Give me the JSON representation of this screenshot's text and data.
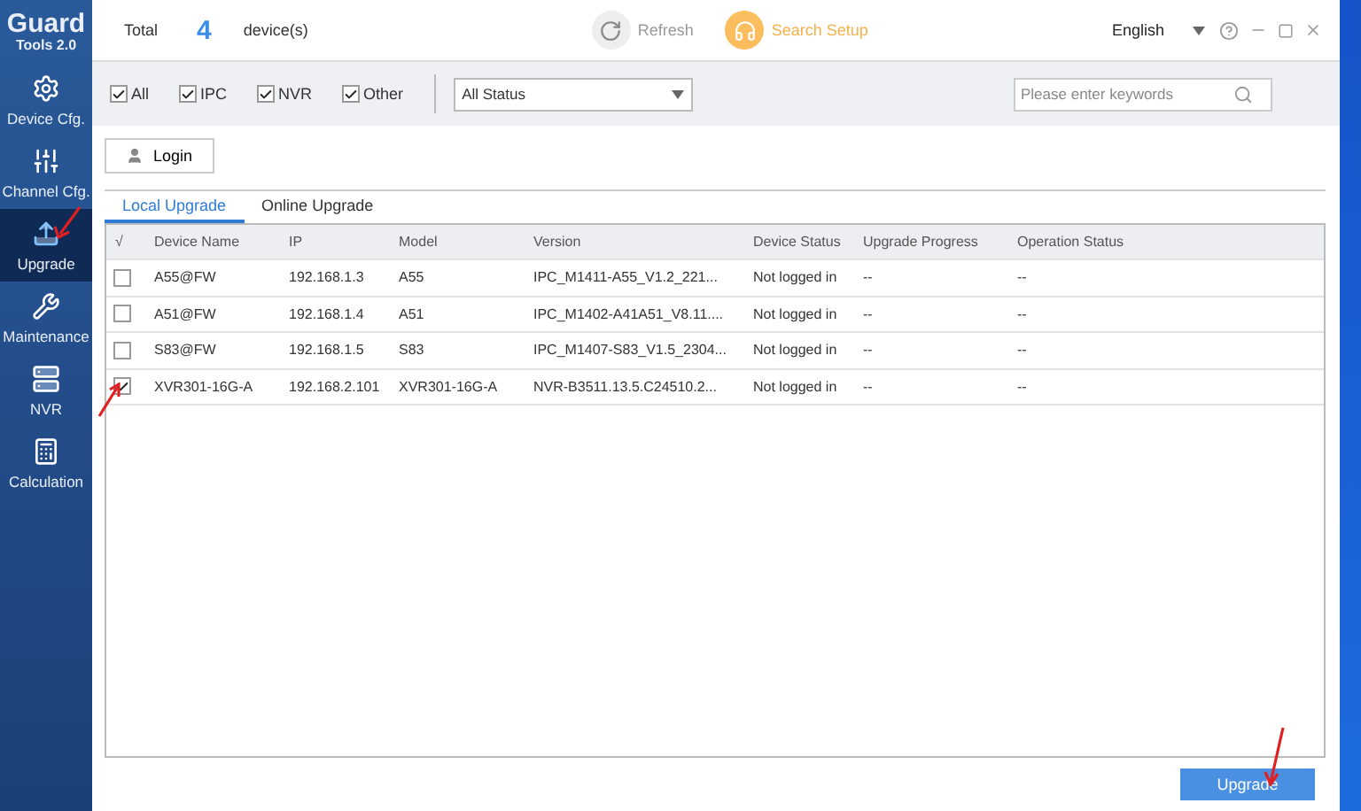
{
  "sidebar": {
    "logo": "Guard",
    "version": "Tools 2.0",
    "items": [
      {
        "label": "Device Cfg.",
        "kind": "gear",
        "selected": false
      },
      {
        "label": "Channel Cfg.",
        "kind": "sliders",
        "selected": false
      },
      {
        "label": "Upgrade",
        "kind": "upgrade",
        "selected": true
      },
      {
        "label": "Maintenance",
        "kind": "tools",
        "selected": false
      },
      {
        "label": "NVR",
        "kind": "nvr",
        "selected": false
      },
      {
        "label": "Calculation",
        "kind": "calc",
        "selected": false
      }
    ]
  },
  "header": {
    "total_label": "Total",
    "count": "4",
    "unit": "device(s)",
    "refresh": "Refresh",
    "search_setup": "Search Setup",
    "language": "English"
  },
  "filters": {
    "types": [
      {
        "label": "All",
        "checked": true
      },
      {
        "label": "IPC",
        "checked": true
      },
      {
        "label": "NVR",
        "checked": true
      },
      {
        "label": "Other",
        "checked": true
      }
    ],
    "status": "All Status",
    "search": {
      "placeholder": "Please enter keywords"
    }
  },
  "login": "Login",
  "tabs": [
    {
      "label": "Local Upgrade",
      "selected": true
    },
    {
      "label": "Online Upgrade",
      "selected": false
    }
  ],
  "table": {
    "select_header": "√",
    "columns": [
      "Device Name",
      "IP",
      "Model",
      "Version",
      "Device Status",
      "Upgrade Progress",
      "Operation Status"
    ],
    "rows": [
      {
        "checked": false,
        "cells": [
          "A55@FW",
          "192.168.1.3",
          "A55",
          "IPC_M1411-A55_V1.2_221...",
          "Not logged in",
          "--",
          "--"
        ]
      },
      {
        "checked": false,
        "cells": [
          "A51@FW",
          "192.168.1.4",
          "A51",
          "IPC_M1402-A41A51_V8.11....",
          "Not logged in",
          "--",
          "--"
        ]
      },
      {
        "checked": false,
        "cells": [
          "S83@FW",
          "192.168.1.5",
          "S83",
          "IPC_M1407-S83_V1.5_2304...",
          "Not logged in",
          "--",
          "--"
        ]
      },
      {
        "checked": true,
        "cells": [
          "XVR301-16G-A",
          "192.168.2.101",
          "XVR301-16G-A",
          "NVR-B3511.13.5.C24510.2...",
          "Not logged in",
          "--",
          "--"
        ]
      }
    ]
  },
  "upgrade_button": "Upgrade"
}
